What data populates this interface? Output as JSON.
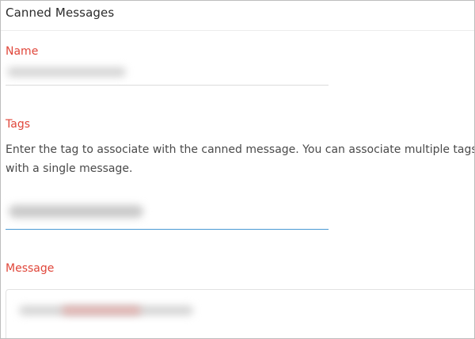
{
  "header": {
    "title": "Canned Messages"
  },
  "form": {
    "name_label": "Name",
    "tags_label": "Tags",
    "tags_description": "Enter the tag to associate with the canned message. You can associate multiple tags with a single message.",
    "message_label": "Message"
  },
  "colors": {
    "label_red": "#e0463a",
    "focus_blue": "#4a9ad4",
    "border_gray": "#bdbdbd"
  }
}
